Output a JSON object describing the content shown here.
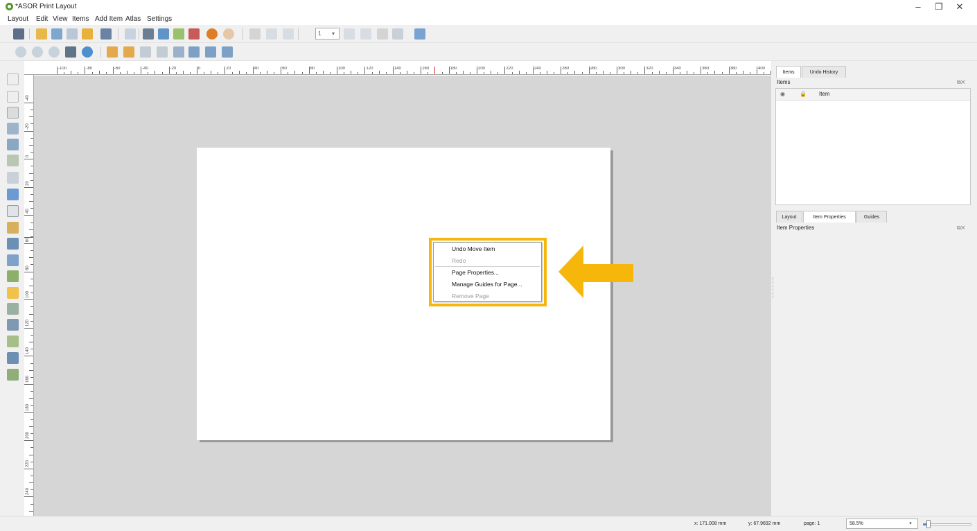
{
  "window": {
    "title": "*ASOR Print Layout",
    "minimize_glyph": "–",
    "maximize_glyph": "❐",
    "close_glyph": "✕"
  },
  "menu": {
    "items": [
      "Layout",
      "Edit",
      "View",
      "Items",
      "Add Item",
      "Atlas",
      "Settings"
    ]
  },
  "toolbar": {
    "page_value": "1"
  },
  "rulers": {
    "horizontal_labels": [
      "-100",
      "-80",
      "-60",
      "-40",
      "-20",
      "0",
      "20",
      "40",
      "60",
      "80",
      "100",
      "120",
      "140",
      "160",
      "180",
      "200",
      "220",
      "240",
      "260",
      "280",
      "300",
      "320",
      "340",
      "360",
      "380",
      "400"
    ],
    "vertical_labels": [
      "-40",
      "-20",
      "0",
      "20",
      "40",
      "60",
      "80",
      "100",
      "120",
      "140",
      "160",
      "180",
      "200",
      "220",
      "240"
    ]
  },
  "context_menu": {
    "highlight_color": "#f6b60a",
    "items": [
      {
        "label": "Undo Move Item",
        "enabled": true
      },
      {
        "label": "Redo",
        "enabled": false
      },
      {
        "label": "Page Properties...",
        "enabled": true
      },
      {
        "label": "Manage Guides for Page...",
        "enabled": true
      },
      {
        "label": "Remove Page",
        "enabled": false
      }
    ]
  },
  "annotation": {
    "arrow_color": "#f6b60a"
  },
  "items_panel": {
    "tabs": [
      "Items",
      "Undo History"
    ],
    "active_tab": "Items",
    "title": "Items",
    "column_header": "Item"
  },
  "properties_panel": {
    "tabs": [
      "Layout",
      "Item Properties",
      "Guides"
    ],
    "active_tab": "Item Properties",
    "title": "Item Properties"
  },
  "panel_controls": "⧉✕",
  "status": {
    "x": "x: 171.008 mm",
    "y": "y: 67.9692 mm",
    "page": "page: 1",
    "zoom": "58.5%"
  }
}
